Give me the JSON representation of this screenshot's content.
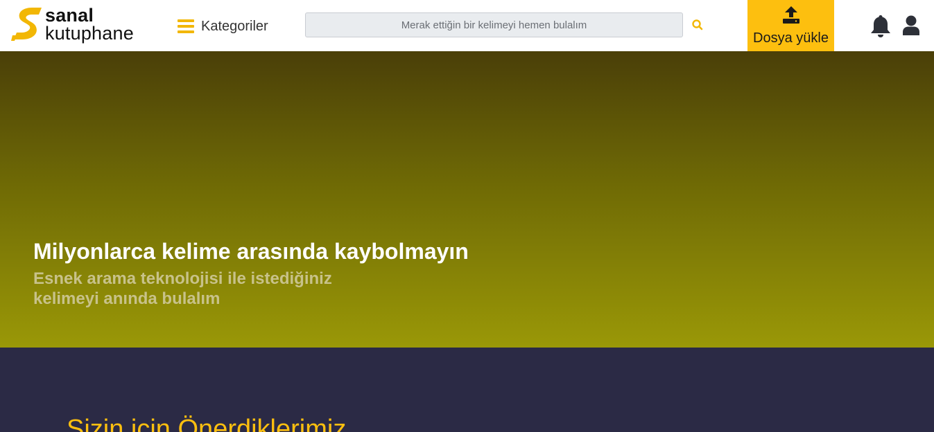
{
  "header": {
    "logo": {
      "line1": "sanal",
      "line2": "kutuphane",
      "icon": "s-logo-icon"
    },
    "categories_label": "Kategoriler",
    "search": {
      "placeholder": "Merak ettiğin bir kelimeyi hemen bulalım",
      "value": "",
      "icon": "search-icon"
    },
    "upload_label": "Dosya yükle",
    "upload_icon": "upload-icon",
    "notification_icon": "bell-icon",
    "account_icon": "user-icon"
  },
  "hero": {
    "title": "Milyonlarca kelime arasında kaybolmayın",
    "subtitle_line1": "Esnek arama teknolojisi ile istediğiniz",
    "subtitle_line2": "kelimeyi anında bulalım"
  },
  "recommendations": {
    "title": "Sizin için Önerdiklerimiz"
  },
  "colors": {
    "accent": "#fdbf0f",
    "hero_top": "#4a3f08",
    "hero_bottom": "#9a9807",
    "section_bg": "#2b2a45"
  }
}
